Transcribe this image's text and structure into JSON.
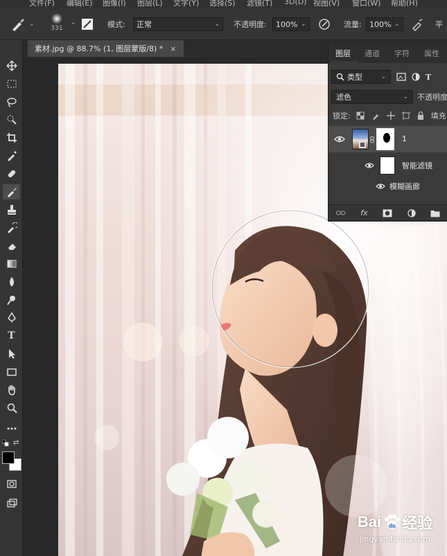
{
  "menu": [
    "文件(F)",
    "编辑(E)",
    "图像(I)",
    "图层(L)",
    "文字(Y)",
    "选择(S)",
    "滤镜(T)",
    "3D(D)",
    "视图(V)",
    "窗口(W)",
    "帮助(H)"
  ],
  "options": {
    "brush_size": "331",
    "mode_label": "模式:",
    "mode_value": "正常",
    "opacity_label": "不透明度:",
    "opacity_value": "100%",
    "flow_label": "流量:",
    "flow_value": "100%",
    "smooth_label": "平"
  },
  "document_tab": {
    "title": "素材.jpg @ 88.7% (1, 图层蒙版/8) *",
    "close": "×"
  },
  "tools": [
    "move-icon",
    "marquee-icon",
    "lasso-icon",
    "quick-select-icon",
    "crop-icon",
    "eyedropper-icon",
    "healing-icon",
    "brush-icon",
    "stamp-icon",
    "history-brush-icon",
    "eraser-icon",
    "gradient-icon",
    "blur-icon",
    "dodge-icon",
    "pen-icon",
    "type-icon",
    "path-select-icon",
    "rectangle-icon",
    "hand-icon",
    "zoom-icon",
    "more-icon"
  ],
  "type_tool_glyph": "T",
  "layers_panel": {
    "tabs": [
      "图层",
      "通道",
      "字符",
      "属性"
    ],
    "filter_kind": "类型",
    "blend_mode": "滤色",
    "opacity_label": "不透明度",
    "lock_label": "锁定:",
    "fill_label": "填充",
    "layer_name": "1",
    "smart_filter_label": "智能滤镜",
    "filter_item_label": "模糊画廊",
    "footer_fx": "fx"
  },
  "watermark": {
    "brand": "Bai",
    "brand_suffix": "经验",
    "url": "jingyan.baidu.com"
  },
  "colors": {
    "foreground": "#000000",
    "background": "#ffffff",
    "ui_dark": "#282828",
    "panel": "#3a3a3a",
    "baidu_blue": "#2d6fd8"
  }
}
